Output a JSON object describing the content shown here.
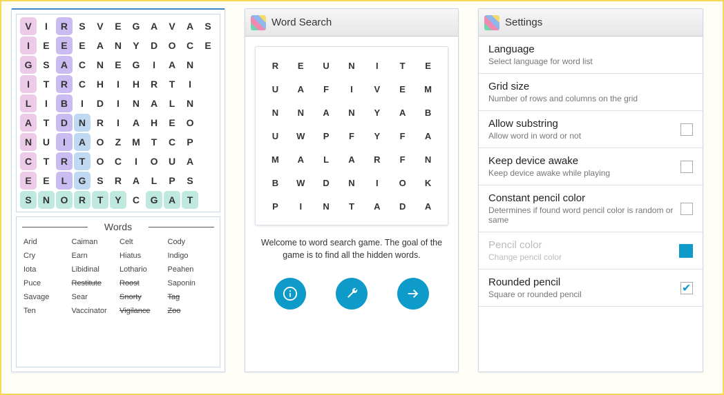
{
  "panel1": {
    "grid": [
      [
        "V",
        "I",
        "R",
        "S",
        "V",
        "E",
        "G",
        "A",
        "V",
        "A",
        "S"
      ],
      [
        "I",
        "E",
        "E",
        "E",
        "A",
        "N",
        "Y",
        "D",
        "O",
        "C",
        "E"
      ],
      [
        "G",
        "S",
        "A",
        "C",
        "N",
        "E",
        "G",
        "I",
        "A",
        "N",
        " "
      ],
      [
        "I",
        "T",
        "R",
        "C",
        "H",
        "I",
        "H",
        "R",
        "T",
        "I",
        " "
      ],
      [
        "L",
        "I",
        "B",
        "I",
        "D",
        "I",
        "N",
        "A",
        "L",
        "N",
        " "
      ],
      [
        "A",
        "T",
        "D",
        "N",
        "R",
        "I",
        "A",
        "H",
        "E",
        "O",
        " "
      ],
      [
        "N",
        "U",
        "I",
        "A",
        "O",
        "Z",
        "M",
        "T",
        "C",
        "P",
        " "
      ],
      [
        "C",
        "T",
        "R",
        "T",
        "O",
        "C",
        "I",
        "O",
        "U",
        "A",
        " "
      ],
      [
        "E",
        "E",
        "L",
        "G",
        "S",
        "R",
        "A",
        "L",
        "P",
        "S",
        " "
      ],
      [
        "S",
        "N",
        "O",
        "R",
        "T",
        "Y",
        "C",
        "G",
        "A",
        "T",
        " "
      ]
    ],
    "words_heading": "Words",
    "words": [
      [
        {
          "t": "Arid"
        },
        {
          "t": "Caiman"
        },
        {
          "t": "Celt"
        },
        {
          "t": "Cody"
        }
      ],
      [
        {
          "t": "Cry"
        },
        {
          "t": "Earn"
        },
        {
          "t": "Hiatus"
        },
        {
          "t": "Indigo"
        }
      ],
      [
        {
          "t": "Iota"
        },
        {
          "t": "Libidinal"
        },
        {
          "t": "Lothario"
        },
        {
          "t": "Peahen"
        }
      ],
      [
        {
          "t": "Puce"
        },
        {
          "t": "Restitute",
          "s": true
        },
        {
          "t": "Roost",
          "s": true
        },
        {
          "t": "Saponin"
        }
      ],
      [
        {
          "t": "Savage"
        },
        {
          "t": "Sear"
        },
        {
          "t": "Snorty",
          "s": true
        },
        {
          "t": "Tag",
          "s": true
        }
      ],
      [
        {
          "t": "Ten"
        },
        {
          "t": "Vaccinator"
        },
        {
          "t": "Vigilance",
          "s": true
        },
        {
          "t": "Zoo",
          "s": true
        }
      ]
    ]
  },
  "panel2": {
    "title": "Word Search",
    "mini_grid": [
      [
        "R",
        "E",
        "U",
        "N",
        "I",
        "T",
        "E"
      ],
      [
        "U",
        "A",
        "F",
        "I",
        "V",
        "E",
        "M"
      ],
      [
        "N",
        "N",
        "A",
        "N",
        "Y",
        "A",
        "B"
      ],
      [
        "U",
        "W",
        "P",
        "F",
        "Y",
        "F",
        "A"
      ],
      [
        "M",
        "A",
        "L",
        "A",
        "R",
        "F",
        "N"
      ],
      [
        "B",
        "W",
        "D",
        "N",
        "I",
        "O",
        "K"
      ],
      [
        "P",
        "I",
        "N",
        "T",
        "A",
        "D",
        "A"
      ]
    ],
    "welcome": "Welcome to word search game. The goal of the game is to find all the hidden words.",
    "icons": [
      "info",
      "wrench",
      "arrow"
    ]
  },
  "panel3": {
    "title": "Settings",
    "items": [
      {
        "label": "Language",
        "sub": "Select language for word list"
      },
      {
        "label": "Grid size",
        "sub": "Number of rows and columns on the grid"
      },
      {
        "label": "Allow substring",
        "sub": "Allow word in word or not",
        "checkbox": true,
        "checked": false
      },
      {
        "label": "Keep device awake",
        "sub": "Keep device awake while playing",
        "checkbox": true,
        "checked": false
      },
      {
        "label": "Constant pencil color",
        "sub": "Determines if found word pencil color is random or same",
        "checkbox": true,
        "checked": false
      },
      {
        "label": "Pencil color",
        "sub": "Change pencil color",
        "swatch": "#0e9bc9",
        "disabled": true
      },
      {
        "label": "Rounded pencil",
        "sub": "Square or rounded pencil",
        "checkbox": true,
        "checked": true
      }
    ]
  }
}
